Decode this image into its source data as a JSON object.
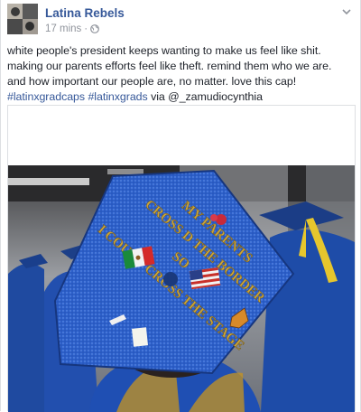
{
  "post": {
    "page_name": "Latina Rebels",
    "timestamp": "17 mins",
    "separator": " · ",
    "privacy_icon": "globe-icon",
    "menu_icon": "chevron-down-icon",
    "text_before_tag1": "white people's president keeps wanting to make us feel like shit. making our parents efforts feel like theft. remind them who we are. and how important our people are, no matter. love this cap! ",
    "hashtag_1": "#latinxgradcaps",
    "hashtag_2": "#latinxgrads",
    "text_via": " via",
    "mention": "@_zamudiocynthia"
  },
  "photo": {
    "cap_text_lines": [
      "MY PARENTS",
      "CROSS D THE BORDER",
      "SO",
      "I COULD CROSS THE STAGE"
    ]
  },
  "colors": {
    "link": "#365899",
    "text": "#1d2129",
    "meta": "#90949c",
    "cap_blue": "#2c5fc9",
    "gold_text": "#c9a43a"
  }
}
